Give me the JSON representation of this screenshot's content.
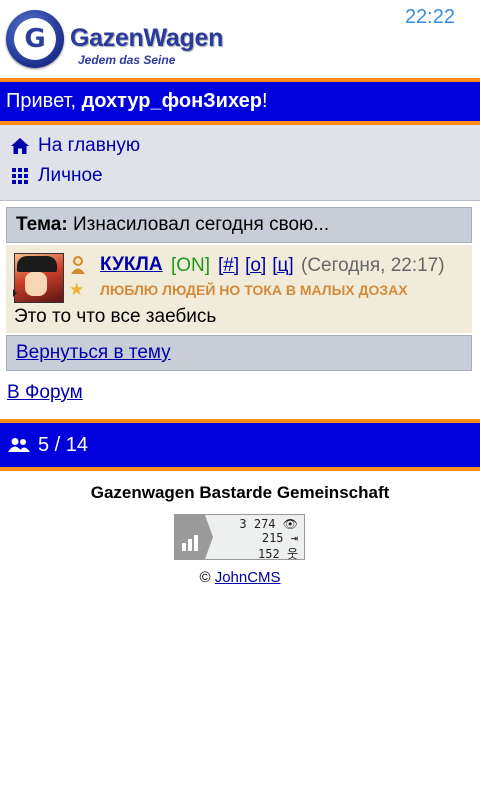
{
  "header": {
    "brand": "GazenWagen",
    "slogan": "Jedem das Seine",
    "clock": "22:22"
  },
  "greeting": {
    "prefix": "Привет, ",
    "username": "дохтур_фонЗихер",
    "suffix": "!"
  },
  "menu": {
    "items": [
      {
        "label": "На главную",
        "icon": "home-icon"
      },
      {
        "label": "Личное",
        "icon": "grid-icon"
      }
    ]
  },
  "topic": {
    "label": "Тема:",
    "title": "Изнасиловал сегодня свою..."
  },
  "post": {
    "author": "КУКЛА",
    "status": "[ON]",
    "links": [
      "[#]",
      "[о]",
      "[ц]"
    ],
    "time": "(Сегодня, 22:17)",
    "mood": "ЛЮБЛЮ ЛЮДЕЙ НО ТОКА В МАЛЫХ ДОЗАХ",
    "text": "Это то что все заебись"
  },
  "nav": {
    "back_label": "Вернуться в тему",
    "forum_label": "В Форум"
  },
  "online": {
    "count": "5 / 14"
  },
  "footer": {
    "site_name": "Gazenwagen Bastarde Gemeinschaft",
    "counter": [
      "3 274",
      "215",
      "152"
    ],
    "copyright": "© ",
    "engine": "JohnCMS"
  },
  "colors": {
    "bar_blue": "#0000dd",
    "bar_orange": "#ff8c1a",
    "link": "#0000aa",
    "online_green": "#1a9a1a",
    "mood": "#d48a3a"
  }
}
